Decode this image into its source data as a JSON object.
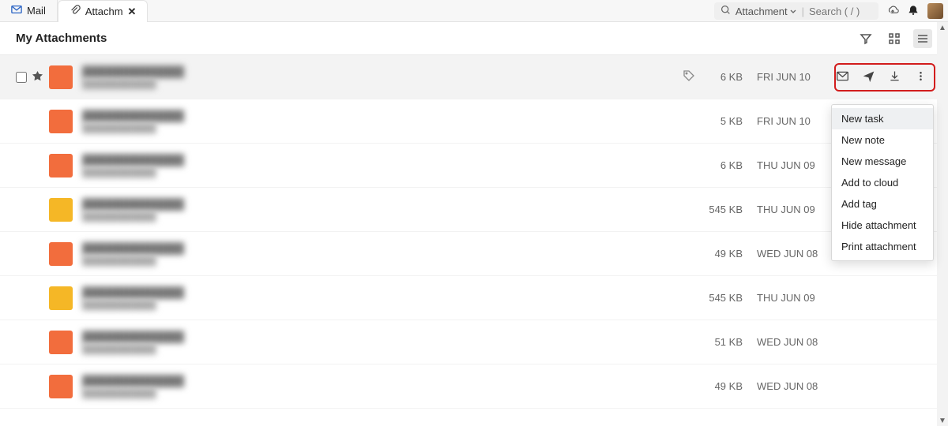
{
  "tabs": [
    {
      "label": "Mail"
    },
    {
      "label": "Attachm"
    }
  ],
  "search": {
    "scope": "Attachment",
    "placeholder": "Search ( / )"
  },
  "page_title": "My Attachments",
  "rows": [
    {
      "size": "6 KB",
      "date": "FRI JUN 10",
      "thumb": "orange",
      "first": true,
      "show_tag": true
    },
    {
      "size": "5 KB",
      "date": "FRI JUN 10",
      "thumb": "orange"
    },
    {
      "size": "6 KB",
      "date": "THU JUN 09",
      "thumb": "orange"
    },
    {
      "size": "545 KB",
      "date": "THU JUN 09",
      "thumb": "yellow"
    },
    {
      "size": "49 KB",
      "date": "WED JUN 08",
      "thumb": "orange"
    },
    {
      "size": "545 KB",
      "date": "THU JUN 09",
      "thumb": "yellow"
    },
    {
      "size": "51 KB",
      "date": "WED JUN 08",
      "thumb": "orange"
    },
    {
      "size": "49 KB",
      "date": "WED JUN 08",
      "thumb": "orange"
    }
  ],
  "row_actions": {
    "mail": "mail-icon",
    "send": "send-icon",
    "download": "download-icon",
    "more": "more-icon"
  },
  "context_menu": [
    "New task",
    "New note",
    "New message",
    "Add to cloud",
    "Add tag",
    "Hide attachment",
    "Print attachment"
  ]
}
